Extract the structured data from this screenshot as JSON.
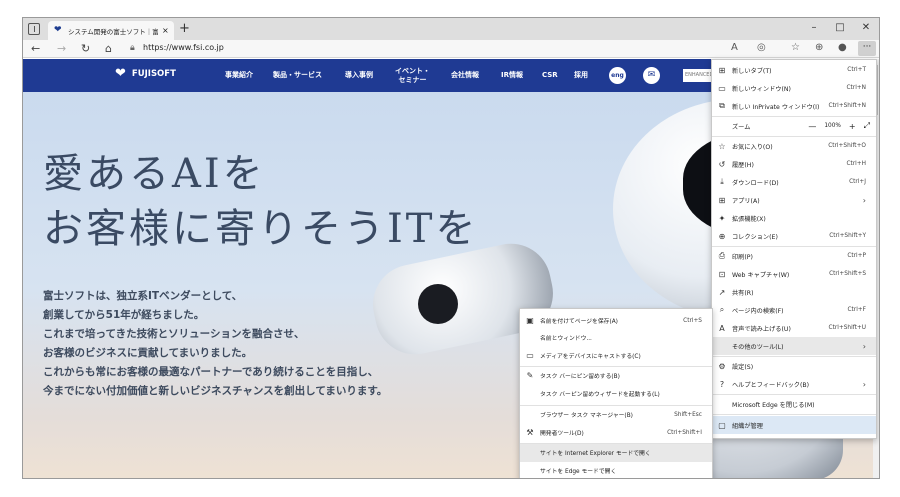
{
  "tab": {
    "title": "システム開発の富士ソフト｜富士ソフ",
    "close_glyph": "×",
    "new_tab_glyph": "+"
  },
  "window_controls": {
    "minimize": "–",
    "maximize": "□",
    "close": "✕"
  },
  "address_bar": {
    "url": "https://www.fsi.co.jp"
  },
  "toolbar_more": "···",
  "site": {
    "logo_text": "FUJISOFT",
    "nav": [
      "事業紹介",
      "製品・サービス",
      "導入事例",
      "イベント・\nセミナー",
      "会社情報",
      "IR情報",
      "CSR",
      "採用"
    ],
    "lang_button": "eng",
    "search_placeholder": "ENHANCED BY Google"
  },
  "hero": {
    "headline_1": "愛あるAIを",
    "headline_2": "お客様に寄りそうITを",
    "body": [
      "富士ソフトは、独立系ITベンダーとして、",
      "創業してから51年が経ちました。",
      "これまで培ってきた技術とソリューションを融合させ、",
      "お客様のビジネスに貢献してまいりました。",
      "これからも常にお客様の最適なパートナーであり続けることを目指し、",
      "今までにない付加価値と新しいビジネスチャンスを創出してまいります。"
    ]
  },
  "main_menu": {
    "items": [
      {
        "icon": "new-tab-icon",
        "glyph": "⊞",
        "label": "新しいタブ(T)",
        "shortcut": "Ctrl+T"
      },
      {
        "icon": "new-window-icon",
        "glyph": "▭",
        "label": "新しいウィンドウ(N)",
        "shortcut": "Ctrl+N"
      },
      {
        "icon": "inprivate-icon",
        "glyph": "⧉",
        "label": "新しい InPrivate ウィンドウ(I)",
        "shortcut": "Ctrl+Shift+N"
      },
      {
        "icon": "favorites-icon",
        "glyph": "☆",
        "label": "お気に入り(O)",
        "shortcut": "Ctrl+Shift+O"
      },
      {
        "icon": "history-icon",
        "glyph": "↺",
        "label": "履歴(H)",
        "shortcut": "Ctrl+H"
      },
      {
        "icon": "download-icon",
        "glyph": "⤓",
        "label": "ダウンロード(D)",
        "shortcut": "Ctrl+J"
      },
      {
        "icon": "apps-icon",
        "glyph": "⊞",
        "label": "アプリ(A)",
        "shortcut": "",
        "arrow": "›"
      },
      {
        "icon": "extensions-icon",
        "glyph": "✦",
        "label": "拡張機能(X)",
        "shortcut": ""
      },
      {
        "icon": "collections-icon",
        "glyph": "⊕",
        "label": "コレクション(E)",
        "shortcut": "Ctrl+Shift+Y"
      },
      {
        "icon": "print-icon",
        "glyph": "⎙",
        "label": "印刷(P)",
        "shortcut": "Ctrl+P"
      },
      {
        "icon": "web-capture-icon",
        "glyph": "⊡",
        "label": "Web キャプチャ(W)",
        "shortcut": "Ctrl+Shift+S"
      },
      {
        "icon": "share-icon",
        "glyph": "↗",
        "label": "共有(R)",
        "shortcut": ""
      },
      {
        "icon": "find-icon",
        "glyph": "⌕",
        "label": "ページ内の検索(F)",
        "shortcut": "Ctrl+F"
      },
      {
        "icon": "read-aloud-icon",
        "glyph": "A",
        "label": "音声で読み上げる(U)",
        "shortcut": "Ctrl+Shift+U"
      },
      {
        "icon": "",
        "glyph": "",
        "label": "その他のツール(L)",
        "shortcut": "",
        "arrow": "›"
      },
      {
        "icon": "settings-icon",
        "glyph": "⚙",
        "label": "設定(S)",
        "shortcut": ""
      },
      {
        "icon": "help-icon",
        "glyph": "?",
        "label": "ヘルプとフィードバック(B)",
        "shortcut": "",
        "arrow": "›"
      },
      {
        "icon": "",
        "glyph": "",
        "label": "Microsoft Edge を閉じる(M)",
        "shortcut": ""
      },
      {
        "icon": "managed-icon",
        "glyph": "▢",
        "label": "組織が管理",
        "shortcut": ""
      }
    ],
    "zoom": {
      "label": "ズーム",
      "minus": "—",
      "value": "100%",
      "plus": "+",
      "fullscreen": "⤢"
    }
  },
  "sub_menu": {
    "items": [
      {
        "icon": "save-page-icon",
        "glyph": "▣",
        "label": "名前を付けてページを保存(A)",
        "shortcut": "Ctrl+S"
      },
      {
        "icon": "",
        "glyph": "",
        "label": "名前とウィンドウ...",
        "shortcut": ""
      },
      {
        "icon": "cast-icon",
        "glyph": "▭",
        "label": "メディアをデバイスにキャストする(C)",
        "shortcut": ""
      },
      {
        "icon": "pin-icon",
        "glyph": "✎",
        "label": "タスク バーにピン留めする(B)",
        "shortcut": ""
      },
      {
        "icon": "",
        "glyph": "",
        "label": "タスク バーピン留めウィザードを起動する(L)",
        "shortcut": ""
      },
      {
        "icon": "",
        "glyph": "",
        "label": "ブラウザー タスク マネージャー(B)",
        "shortcut": "Shift+Esc"
      },
      {
        "icon": "devtools-icon",
        "glyph": "⚒",
        "label": "開発者ツール(D)",
        "shortcut": "Ctrl+Shift+I"
      },
      {
        "icon": "",
        "glyph": "",
        "label": "サイトを Internet Explorer モードで開く",
        "shortcut": ""
      },
      {
        "icon": "",
        "glyph": "",
        "label": "サイトを Edge モードで開く",
        "shortcut": ""
      }
    ]
  }
}
